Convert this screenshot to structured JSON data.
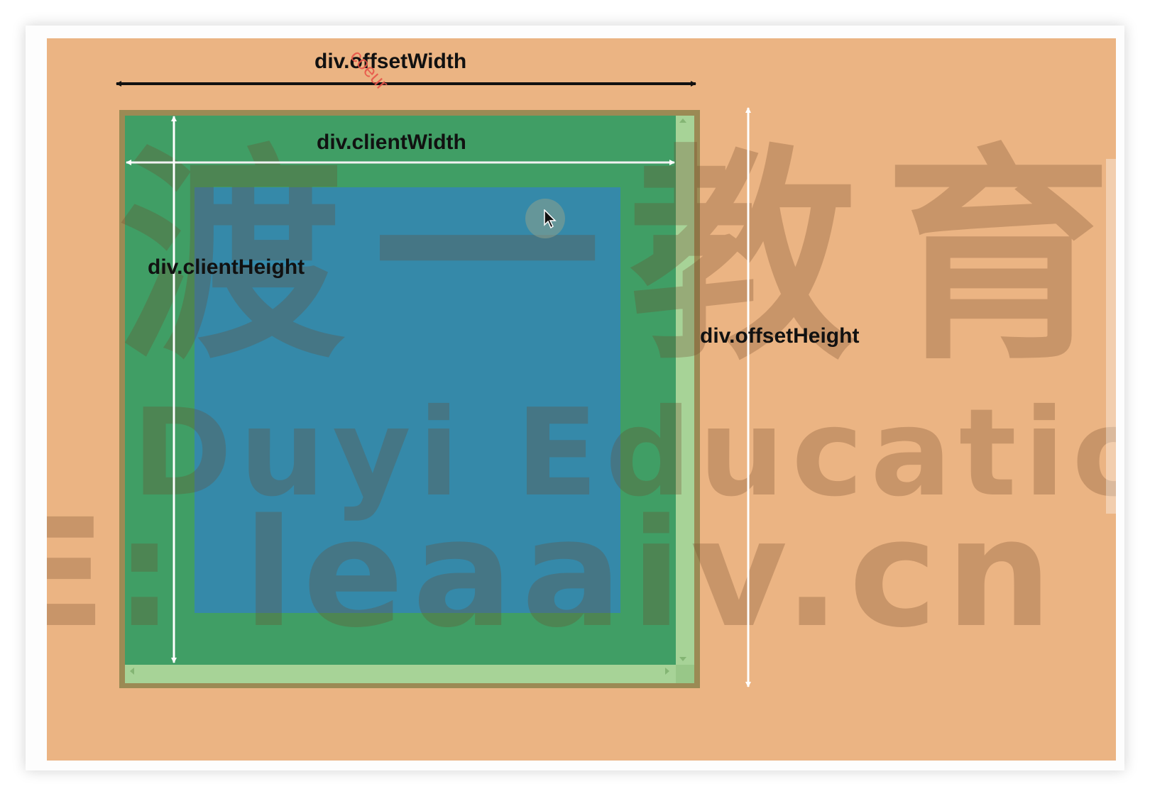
{
  "labels": {
    "offset_width": "div.offsetWidth",
    "client_width": "div.clientWidth",
    "client_height": "div.clientHeight",
    "offset_height": "div.offsetHeight"
  },
  "watermark": {
    "chinese": "渡一教育",
    "english": "Duyi Education",
    "url": "E: leaaiv.cn"
  },
  "stamp_text": "coeur",
  "colors": {
    "background": "#ebb483",
    "border": "#9b8a54",
    "padding": "#409e65",
    "content": "#3589a9",
    "scrollbar": "#a7d397",
    "arrow_outer": "#111111",
    "arrow_inner": "#ffffff"
  }
}
